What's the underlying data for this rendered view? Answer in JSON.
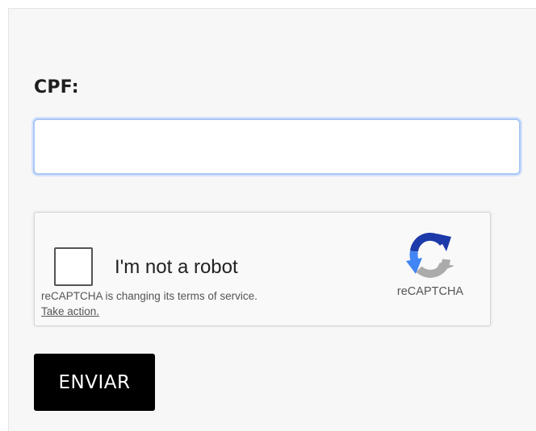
{
  "form": {
    "cpf_label": "CPF:",
    "cpf_value": "",
    "cpf_placeholder": "",
    "submit_label": "ENVIAR"
  },
  "recaptcha": {
    "checkbox_label": "I'm not a robot",
    "checked": false,
    "notice": "reCAPTCHA is changing its terms of service.",
    "action_link": "Take action.",
    "brand": "reCAPTCHA",
    "logo_icon": "recaptcha-logo-icon"
  },
  "colors": {
    "input_focus_border": "#a9c6f5",
    "button_bg": "#000000",
    "button_text": "#ffffff",
    "recaptcha_blue": "#1c3aa9",
    "recaptcha_light_blue": "#4285f4",
    "recaptcha_gray": "#ababab"
  }
}
